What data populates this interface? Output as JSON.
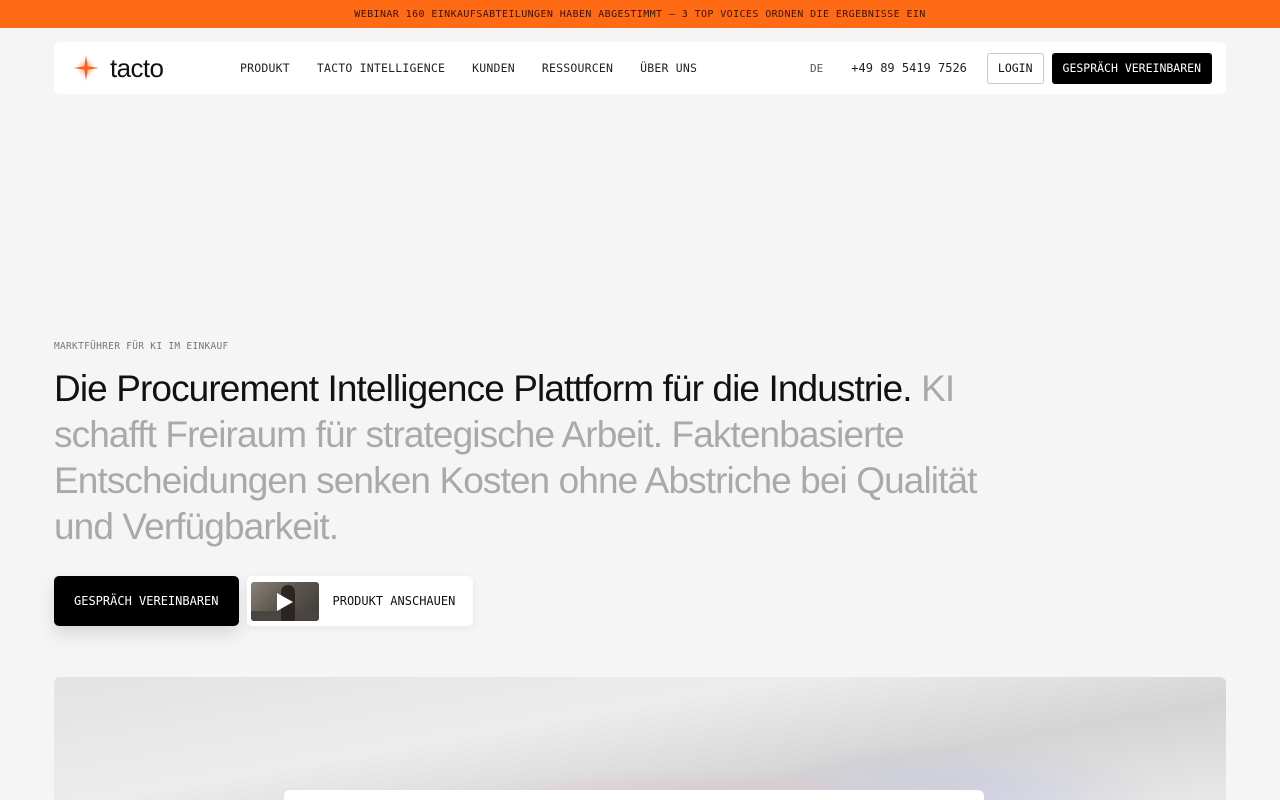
{
  "banner": {
    "text": "WEBINAR 160 EINKAUFSABTEILUNGEN HABEN ABGESTIMMT — 3 TOP VOICES ORDNEN DIE ERGEBNISSE EIN",
    "color": "#ff6a14"
  },
  "nav": {
    "logo_text": "tacto",
    "logo_icon": "sparkle-icon",
    "links": [
      {
        "label": "PRODUKT"
      },
      {
        "label": "TACTO INTELLIGENCE"
      },
      {
        "label": "KUNDEN"
      },
      {
        "label": "RESSOURCEN"
      },
      {
        "label": "ÜBER UNS"
      }
    ],
    "language": "DE",
    "phone": "+49 89 5419 7526",
    "login_label": "LOGIN",
    "cta_label": "GESPRÄCH VEREINBAREN"
  },
  "hero": {
    "eyebrow": "MARKTFÜHRER FÜR KI IM EINKAUF",
    "headline_dark": "Die Procurement Intelligence Plattform für die Industrie.",
    "headline_light": "KI schafft Freiraum für strategische Arbeit. Faktenbasierte Entscheidungen senken Kosten ohne Abstriche bei Qualität und Verfügbarkeit.",
    "primary_cta": "GESPRÄCH VEREINBAREN",
    "video_cta": "PRODUKT ANSCHAUEN",
    "video_icon": "play-icon"
  },
  "colors": {
    "accent": "#ff6a14",
    "logo_mark": "#ff5a1f",
    "primary_button": "#000000"
  }
}
